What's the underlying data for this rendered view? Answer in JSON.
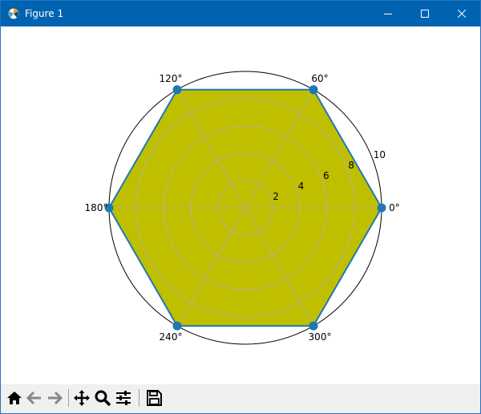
{
  "window": {
    "title": "Figure 1",
    "controls": [
      "minimize",
      "maximize",
      "close"
    ],
    "title_bar_color": "#0063b1"
  },
  "toolbar": {
    "buttons": [
      {
        "name": "home",
        "icon": "home-icon"
      },
      {
        "name": "back",
        "icon": "arrow-left-icon"
      },
      {
        "name": "forward",
        "icon": "arrow-right-icon"
      },
      {
        "name": "pan",
        "icon": "move-icon"
      },
      {
        "name": "zoom",
        "icon": "magnifier-icon"
      },
      {
        "name": "configure-subplots",
        "icon": "sliders-icon"
      },
      {
        "name": "save",
        "icon": "floppy-disk-icon"
      }
    ]
  },
  "chart_data": {
    "type": "radar",
    "projection": "polar",
    "theta_deg": [
      0,
      60,
      120,
      180,
      240,
      300
    ],
    "r": [
      10,
      10,
      10,
      10,
      10,
      10
    ],
    "closed": true,
    "rlim": [
      0,
      10
    ],
    "r_ticks": [
      "2",
      "4",
      "6",
      "8",
      "10"
    ],
    "theta_ticks": [
      "0°",
      "60°",
      "120°",
      "180°",
      "240°",
      "300°"
    ],
    "grid": true,
    "colors": {
      "fill": "#bfbf00",
      "line": "#1f77b4",
      "marker": "#1f77b4",
      "grid": "#b0b0b0",
      "frame": "#000000"
    }
  }
}
